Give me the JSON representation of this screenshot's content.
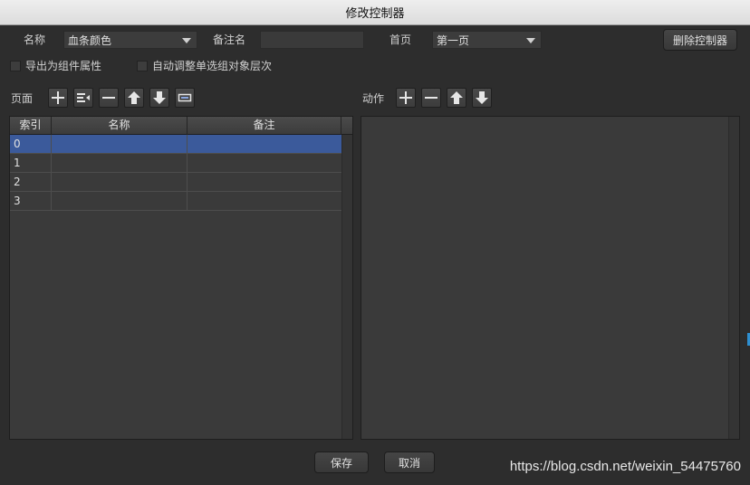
{
  "window": {
    "title": "修改控制器"
  },
  "controller": {
    "name_label": "名称",
    "name_value": "血条颜色",
    "remark_label": "备注名",
    "remark_value": "",
    "homepage_label": "首页",
    "homepage_value": "第一页",
    "delete_button": "删除控制器"
  },
  "options": {
    "export_as_property": "导出为组件属性",
    "auto_adjust_order": "自动调整单选组对象层次"
  },
  "pages": {
    "label": "页面",
    "columns": [
      "索引",
      "名称",
      "备注"
    ],
    "rows": [
      {
        "index": "0",
        "name": "",
        "remark": ""
      },
      {
        "index": "1",
        "name": "",
        "remark": ""
      },
      {
        "index": "2",
        "name": "",
        "remark": ""
      },
      {
        "index": "3",
        "name": "",
        "remark": ""
      }
    ],
    "selected_index": 0
  },
  "actions": {
    "label": "动作"
  },
  "footer": {
    "save": "保存",
    "cancel": "取消"
  },
  "watermark": "https://blog.csdn.net/weixin_54475760",
  "colors": {
    "background": "#2d2d2d",
    "selection": "#3b5a9b",
    "panel": "#3a3a3a"
  }
}
